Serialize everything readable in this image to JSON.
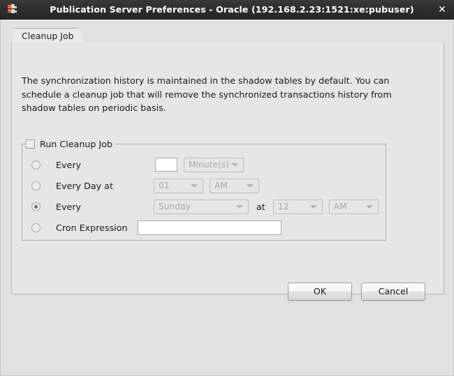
{
  "window": {
    "title": "Publication Server Preferences - Oracle (192.168.2.23:1521:xe:pubuser)",
    "close_label": "✕",
    "icon_name": "app-icon"
  },
  "tabs": [
    {
      "label": "Cleanup Job",
      "selected": true
    }
  ],
  "content": {
    "description": "The synchronization history is maintained in the shadow tables by default. You can schedule a cleanup job that will remove the synchronized transactions history from shadow tables on periodic basis."
  },
  "group": {
    "label": "Run Cleanup Job",
    "checked": false,
    "rows": [
      {
        "id": "every-interval",
        "radio_selected": false,
        "label": "Every",
        "value_field": "",
        "unit_select": "Minute(s)"
      },
      {
        "id": "every-day-at",
        "radio_selected": false,
        "label": "Every Day at",
        "hour_select": "01",
        "meridiem_select": "AM"
      },
      {
        "id": "every-weekday-at",
        "radio_selected": true,
        "label": "Every",
        "day_select": "Sunday",
        "at_label": "at",
        "hour_select": "12",
        "meridiem_select": "AM"
      },
      {
        "id": "cron-expression",
        "radio_selected": false,
        "label": "Cron Expression",
        "value_field": ""
      }
    ]
  },
  "footer": {
    "ok_label": "OK",
    "cancel_label": "Cancel"
  },
  "colors": {
    "titlebar": "#2e2e2e",
    "window_bg": "#e1e1e1",
    "panel_bg": "#e6e6e6",
    "accent_icon": "#e06a28"
  }
}
